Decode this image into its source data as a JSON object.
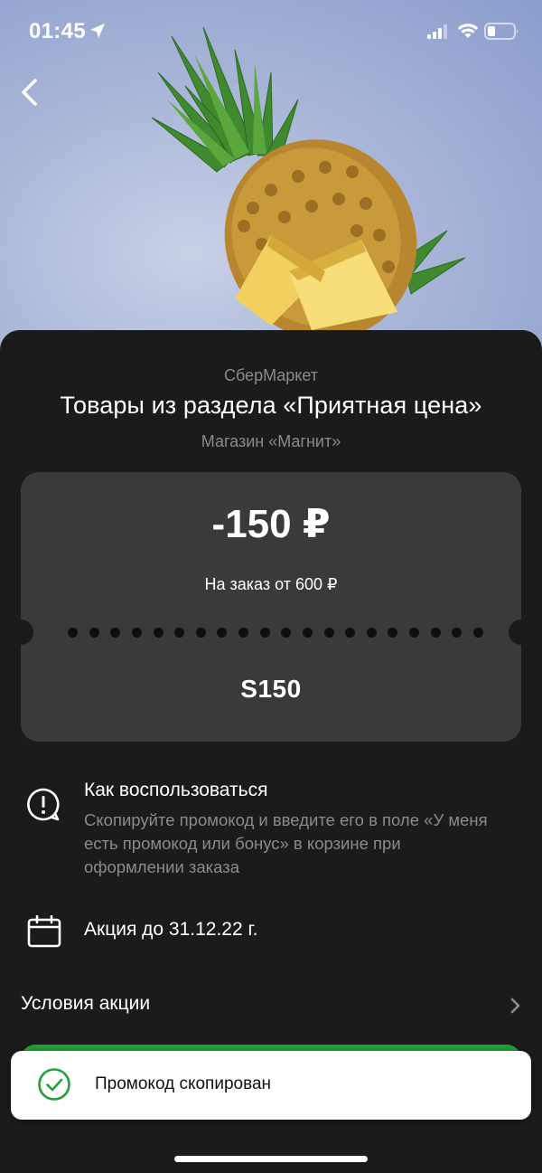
{
  "status_bar": {
    "time": "01:45"
  },
  "hero": {
    "image": "pineapple-photo"
  },
  "header": {
    "provider": "СберМаркет",
    "title": "Товары из раздела «Приятная цена»",
    "shop": "Магазин «Магнит»"
  },
  "ticket": {
    "discount": "-150 ₽",
    "min_order": "На заказ от 600 ₽",
    "code": "S150"
  },
  "how_to": {
    "title": "Как воспользоваться",
    "text": "Скопируйте промокод и введите его в поле «У меня есть промокод или бонус» в корзине при оформлении заказа"
  },
  "validity": {
    "text": "Акция до 31.12.22 г."
  },
  "terms": {
    "label": "Условия акции"
  },
  "toast": {
    "text": "Промокод скопирован"
  },
  "colors": {
    "sheet_bg": "#1b1b1b",
    "ticket_bg": "#3a3a3c",
    "accent_green": "#21a038",
    "muted_text": "#8a8a8f"
  }
}
